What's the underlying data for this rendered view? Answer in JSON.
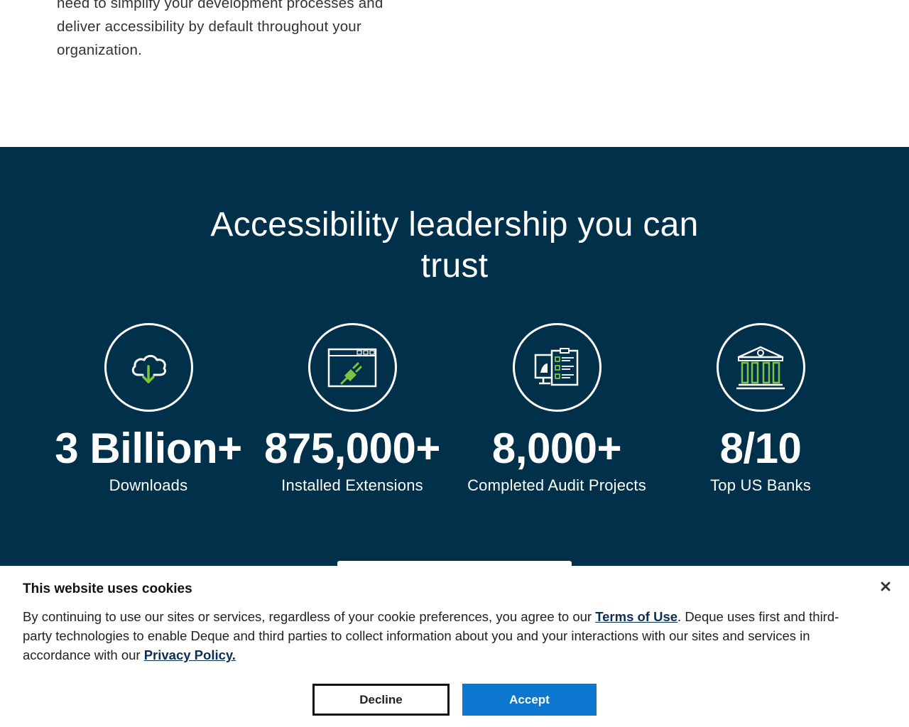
{
  "intro": {
    "line1": "need to simplify your development processes and",
    "line2": "deliver accessibility by default throughout your",
    "line3": "organization."
  },
  "stats": {
    "title_line1": "Accessibility leadership you can",
    "title_line2": "trust",
    "items": [
      {
        "icon": "cloud-download-icon",
        "number": "3 Billion+",
        "label": "Downloads"
      },
      {
        "icon": "browser-extension-icon",
        "number": "875,000+",
        "label": "Installed Extensions"
      },
      {
        "icon": "audit-checklist-icon",
        "number": "8,000+",
        "label": "Completed Audit Projects"
      },
      {
        "icon": "bank-icon",
        "number": "8/10",
        "label": "Top US Banks"
      }
    ]
  },
  "cookie": {
    "title": "This website uses cookies",
    "text_part1": "By continuing to use our sites or services, regardless of your cookie preferences, you agree to our ",
    "terms_link": "Terms of Use",
    "text_part2": ". Deque uses first and third-party technologies to enable Deque and third parties to collect information about you and your interactions with our sites and services in accordance with our ",
    "privacy_link": "Privacy Policy.",
    "decline_label": "Decline",
    "accept_label": "Accept"
  },
  "colors": {
    "band": "#01314a",
    "accent_green": "#7dc242",
    "accept_blue": "#0b77cf",
    "link": "#0a2f54"
  }
}
